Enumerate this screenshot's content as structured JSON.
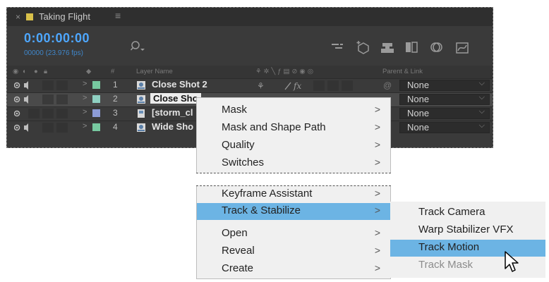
{
  "tab": {
    "close_glyph": "×",
    "title": "Taking Flight",
    "menu_glyph": "≡",
    "swatch_color": "#d8c04a"
  },
  "toolbar": {
    "timecode": "0:00:00:00",
    "fps": "00000 (23.976 fps)",
    "search_placeholder": "",
    "icons": [
      "composition-mini-flowchart-icon",
      "draft-3d-icon",
      "shy-layers-icon",
      "frame-blending-icon",
      "motion-blur-icon",
      "graph-editor-icon"
    ]
  },
  "columns": {
    "layer_name": "Layer Name",
    "parent_link": "Parent & Link",
    "number": "#"
  },
  "layers": [
    {
      "num": "1",
      "name": "Close Shot 2",
      "color": "#77c9a0",
      "parent": "None",
      "selected": false
    },
    {
      "num": "2",
      "name": "Close Sho",
      "color": "#8fd0c2",
      "parent": "None",
      "selected": true
    },
    {
      "num": "3",
      "name": "[storm_cl",
      "color": "#8c9bd6",
      "parent": "None",
      "selected": false
    },
    {
      "num": "4",
      "name": "Wide Sho",
      "color": "#77c9a0",
      "parent": "None",
      "selected": false
    }
  ],
  "context_menu": {
    "group1": [
      {
        "label": "Mask",
        "submenu": ">"
      },
      {
        "label": "Mask and Shape Path",
        "submenu": ">"
      },
      {
        "label": "Quality",
        "submenu": ">"
      },
      {
        "label": "Switches",
        "submenu": ">"
      }
    ],
    "group2": [
      {
        "label": "Keyframe Assistant",
        "submenu": ">"
      },
      {
        "label": "Track & Stabilize",
        "submenu": ">"
      },
      {
        "label": "Open",
        "submenu": ">"
      },
      {
        "label": "Reveal",
        "submenu": ">"
      },
      {
        "label": "Create",
        "submenu": ">"
      }
    ]
  },
  "submenu": {
    "items": [
      {
        "label": "Track Camera"
      },
      {
        "label": "Warp Stabilizer VFX"
      },
      {
        "label": "Track Motion"
      },
      {
        "label": "Track Mask"
      }
    ]
  },
  "colors": {
    "highlight": "#6cb4e4",
    "timecode": "#4ea7ff",
    "panel_bg": "#3a3a3a",
    "menu_bg": "#f0f0f0"
  }
}
